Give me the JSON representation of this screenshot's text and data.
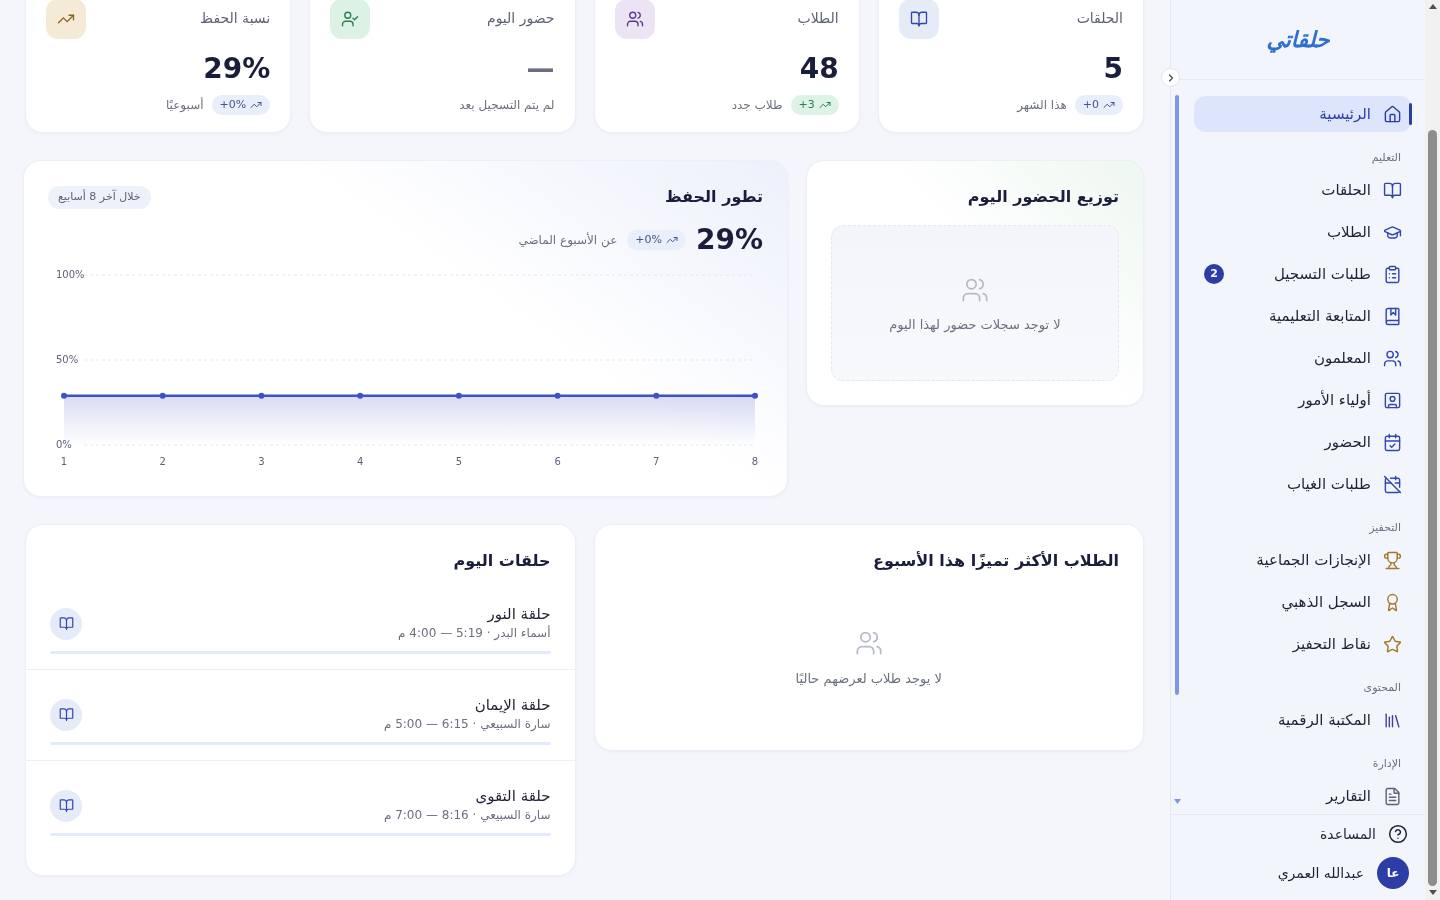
{
  "sidebar": {
    "logo": "حلقاتي",
    "sections": [
      {
        "items": [
          {
            "label": "الرئيسية",
            "selected": true
          }
        ]
      },
      {
        "title": "التعليم",
        "items": [
          {
            "label": "الحلقات",
            "selected": false
          },
          {
            "label": "الطلاب",
            "selected": false
          },
          {
            "label": "طلبات التسجيل",
            "selected": false,
            "badge": "2"
          },
          {
            "label": "المتابعة التعليمية",
            "selected": false
          },
          {
            "label": "المعلمون",
            "selected": false
          },
          {
            "label": "أولياء الأمور",
            "selected": false
          },
          {
            "label": "الحضور",
            "selected": false
          },
          {
            "label": "طلبات الغياب",
            "selected": false
          }
        ]
      },
      {
        "title": "التحفيز",
        "items": [
          {
            "label": "الإنجازات الجماعية",
            "selected": false
          },
          {
            "label": "السجل الذهبي",
            "selected": false
          },
          {
            "label": "نقاط التحفيز",
            "selected": false
          }
        ]
      },
      {
        "title": "المحتوى",
        "items": [
          {
            "label": "المكتبة الرقمية",
            "selected": false
          }
        ]
      },
      {
        "title": "الإدارة",
        "items": [
          {
            "label": "التقارير",
            "selected": false
          }
        ]
      }
    ],
    "help": "المساعدة",
    "user": {
      "initials": "عا",
      "name": "عبدالله العمري"
    }
  },
  "stat_cards": [
    {
      "title": "الحلقات",
      "value": "5",
      "pending": false,
      "change": {
        "text": "+0",
        "positive": false
      },
      "note": "هذا الشهر"
    },
    {
      "title": "الطلاب",
      "value": "48",
      "pending": false,
      "change": {
        "text": "+3",
        "positive": true
      },
      "note": "طلاب جدد"
    },
    {
      "title": "حضور اليوم",
      "value": "—",
      "pending": true,
      "note": "لم يتم التسجيل بعد"
    },
    {
      "title": "نسبة الحفظ",
      "value": "29%",
      "pending": false,
      "change": {
        "text": "+0%",
        "positive": false
      },
      "note": "أسبوعيًا"
    }
  ],
  "attendance_distribution": {
    "title": "توزيع الحضور اليوم",
    "empty_message": "لا توجد سجلات حضور لهذا اليوم"
  },
  "memorization_progress": {
    "title": "تطور الحفظ",
    "period": "خلال آخر 8 أسابيع",
    "value": "29%",
    "change": {
      "text": "+0%",
      "positive": false
    },
    "change_note": "عن الأسبوع الماضي",
    "chart_data": {
      "type": "area",
      "x": [
        1,
        2,
        3,
        4,
        5,
        6,
        7,
        8
      ],
      "series": [
        {
          "color": "#3f51c5",
          "values": [
            29,
            29,
            29,
            29,
            29,
            29,
            29,
            29
          ]
        }
      ],
      "xlim": [
        1,
        8
      ],
      "ylim": [
        0,
        100
      ],
      "xticks": [
        1,
        2,
        3,
        4,
        5,
        6,
        7,
        8
      ],
      "yticks": [
        {
          "value": 0,
          "label": "0%"
        },
        {
          "value": 50,
          "label": "50%"
        },
        {
          "value": 100,
          "label": "100%"
        }
      ]
    }
  },
  "top_students": {
    "title": "الطلاب الأكثر تميزًا هذا الأسبوع",
    "empty_message": "لا يوجد طلاب لعرضهم حاليًا"
  },
  "todays_circles": {
    "title": "حلقات اليوم",
    "rows": [
      {
        "name": "حلقة النور",
        "details": "أسماء البدر · 5:19 — 4:00 م"
      },
      {
        "name": "حلقة الإيمان",
        "details": "سارة السبيعي · 6:15 — 5:00 م"
      },
      {
        "name": "حلقة التقوى",
        "details": "سارة السبيعي · 8:16 — 7:00 م"
      }
    ]
  }
}
